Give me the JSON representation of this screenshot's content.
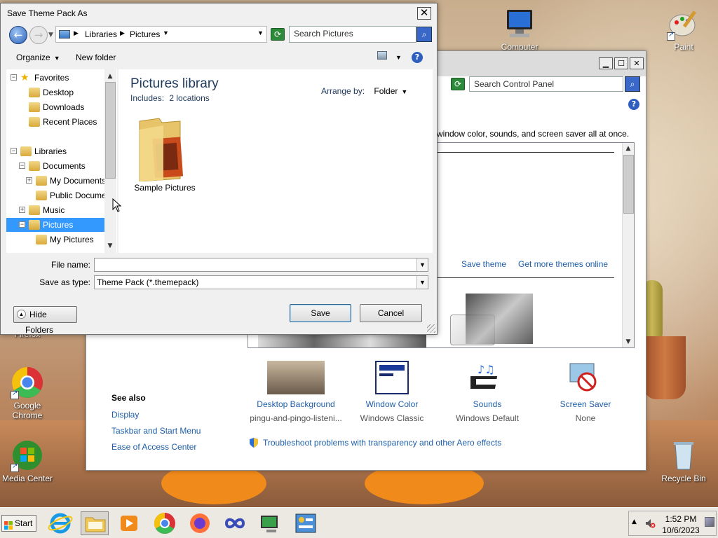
{
  "desktop": {
    "icons": {
      "computer": "Computer",
      "paint": "Paint",
      "firefox": "Firefox",
      "chrome": "Google Chrome",
      "media_center": "Media Center",
      "recycle_bin": "Recycle Bin"
    }
  },
  "control_panel": {
    "search_placeholder": "Search Control Panel",
    "description": "window color, sounds, and screen saver all at once.",
    "save_theme_link": "Save theme",
    "get_more_link": "Get more themes online",
    "bottom_items": [
      {
        "label": "Desktop Background",
        "value": "pingu-and-pingo-listeni..."
      },
      {
        "label": "Window Color",
        "value": "Windows Classic"
      },
      {
        "label": "Sounds",
        "value": "Windows Default"
      },
      {
        "label": "Screen Saver",
        "value": "None"
      }
    ],
    "see_also": {
      "heading": "See also",
      "links": [
        "Display",
        "Taskbar and Start Menu",
        "Ease of Access Center"
      ]
    },
    "troubleshoot_link": "Troubleshoot problems with transparency and other Aero effects"
  },
  "dialog": {
    "title": "Save Theme Pack As",
    "breadcrumb": [
      "Libraries",
      "Pictures"
    ],
    "search_placeholder": "Search Pictures",
    "toolbar": {
      "organize": "Organize",
      "new_folder": "New folder"
    },
    "nav_tree": [
      {
        "label": "Favorites",
        "level": 0,
        "expander": "−"
      },
      {
        "label": "Desktop",
        "level": 1,
        "expander": ""
      },
      {
        "label": "Downloads",
        "level": 1,
        "expander": ""
      },
      {
        "label": "Recent Places",
        "level": 1,
        "expander": ""
      },
      {
        "label": "Libraries",
        "level": 0,
        "expander": "−"
      },
      {
        "label": "Documents",
        "level": 1,
        "expander": "−"
      },
      {
        "label": "My Documents",
        "level": 2,
        "expander": "+"
      },
      {
        "label": "Public Documents",
        "level": 2,
        "expander": ""
      },
      {
        "label": "Music",
        "level": 1,
        "expander": "+"
      },
      {
        "label": "Pictures",
        "level": 1,
        "expander": "−",
        "selected": true
      },
      {
        "label": "My Pictures",
        "level": 2,
        "expander": ""
      }
    ],
    "library_title": "Pictures library",
    "library_includes_label": "Includes:",
    "library_includes_value": "2 locations",
    "arrange_label": "Arrange by:",
    "arrange_value": "Folder",
    "folders": [
      "Sample Pictures"
    ],
    "file_name_label": "File name:",
    "file_name_value": "",
    "save_type_label": "Save as type:",
    "save_type_value": "Theme Pack (*.themepack)",
    "hide_folders": "Hide Folders",
    "save_button": "Save",
    "cancel_button": "Cancel"
  },
  "taskbar": {
    "start": "Start",
    "time": "1:52 PM",
    "date": "10/6/2023"
  }
}
